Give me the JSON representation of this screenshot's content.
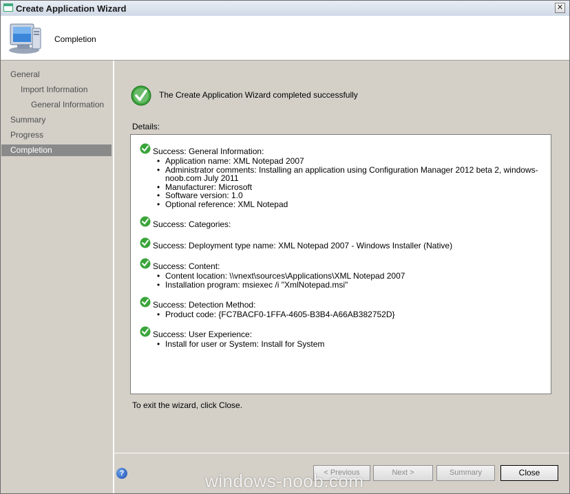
{
  "window": {
    "title": "Create Application Wizard",
    "close_symbol": "✕"
  },
  "header": {
    "title": "Completion",
    "icon": "computer-icon"
  },
  "nav": {
    "items": [
      {
        "label": "General",
        "indent": 0,
        "active": false
      },
      {
        "label": "Import Information",
        "indent": 1,
        "active": false
      },
      {
        "label": "General Information",
        "indent": 2,
        "active": false
      },
      {
        "label": "Summary",
        "indent": 0,
        "active": false
      },
      {
        "label": "Progress",
        "indent": 0,
        "active": false
      },
      {
        "label": "Completion",
        "indent": 0,
        "active": true
      }
    ]
  },
  "content": {
    "status_text": "The Create Application Wizard completed successfully",
    "details_label": "Details:",
    "sections": [
      {
        "title": "Success: General Information:",
        "bullets": [
          "Application name: XML Notepad 2007",
          "Administrator comments: Installing an application using Configuration Manager 2012 beta 2, windows-noob.com July 2011",
          "Manufacturer: Microsoft",
          "Software version: 1.0",
          "Optional reference: XML Notepad"
        ]
      },
      {
        "title": "Success: Categories:",
        "bullets": []
      },
      {
        "title": "Success: Deployment type name: XML Notepad 2007 - Windows Installer (Native)",
        "bullets": []
      },
      {
        "title": "Success: Content:",
        "bullets": [
          "Content location: \\\\vnext\\sources\\Applications\\XML Notepad 2007",
          "Installation program: msiexec /i \"XmlNotepad.msi\""
        ]
      },
      {
        "title": "Success: Detection Method:",
        "bullets": [
          "Product code: {FC7BACF0-1FFA-4605-B3B4-A66AB382752D}"
        ]
      },
      {
        "title": "Success: User Experience:",
        "bullets": [
          "Install for user or System: Install for System"
        ]
      }
    ],
    "exit_text": "To exit the wizard, click Close."
  },
  "footer": {
    "help_symbol": "?",
    "previous_label": "< Previous",
    "next_label": "Next >",
    "summary_label": "Summary",
    "close_label": "Close"
  },
  "watermark": "windows-noob.com",
  "colors": {
    "success_green": "#3aa53a",
    "nav_active": "#8a8a8a"
  }
}
